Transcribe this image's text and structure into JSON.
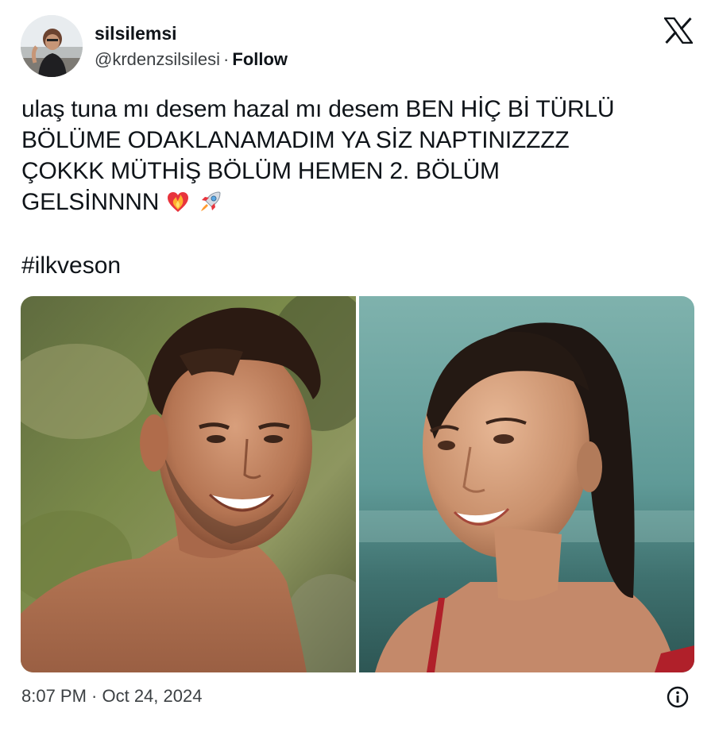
{
  "user": {
    "display_name": "silsilemsi",
    "handle": "@krdenzsilsilesi",
    "separator": "·",
    "follow_label": "Follow"
  },
  "tweet": {
    "text_lines": [
      "ulaş tuna mı desem hazal mı desem BEN HİÇ Bİ TÜRLÜ",
      "BÖLÜME ODAKLANAMADIM YA SİZ NAPTINIZZZZ",
      "ÇOKKK MÜTHİŞ BÖLÜM HEMEN 2. BÖLÜM",
      "GELSİNNNN"
    ],
    "emojis": [
      "heart-on-fire-icon",
      "rocket-icon"
    ],
    "hashtag": "#ilkveson",
    "timestamp": "8:07 PM · Oct 24, 2024"
  },
  "icons": {
    "brand": "x-logo-icon",
    "info": "info-icon"
  },
  "colors": {
    "text": "#0f1419",
    "secondary_text": "#3c4043",
    "background": "#ffffff"
  }
}
